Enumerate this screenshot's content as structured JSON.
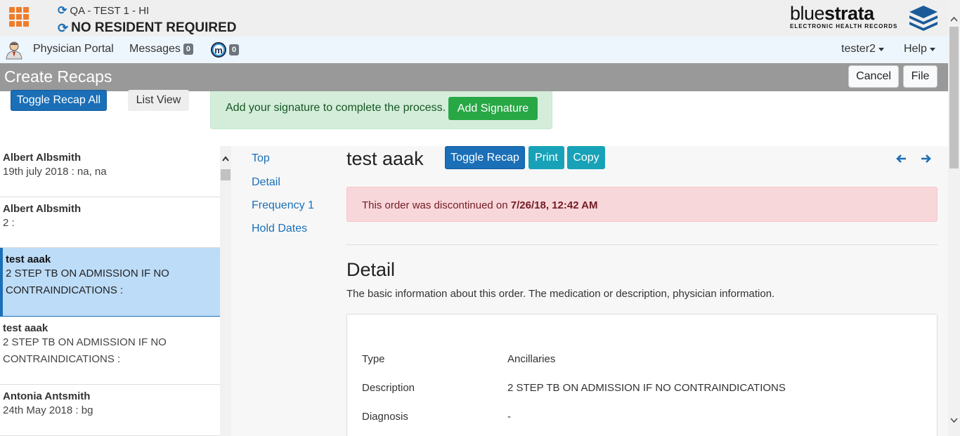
{
  "header": {
    "facility": "QA - TEST 1 - HI",
    "resident": "NO RESIDENT REQUIRED",
    "logo": {
      "name_light": "blue",
      "name_bold": "strata",
      "tagline": "ELECTRONIC HEALTH RECORDS"
    }
  },
  "nav": {
    "physician_portal": "Physician Portal",
    "messages": "Messages",
    "messages_count": "0",
    "m_count": "0",
    "user": "tester2",
    "help": "Help"
  },
  "titlebar": {
    "title": "Create Recaps",
    "cancel": "Cancel",
    "file": "File"
  },
  "controls": {
    "toggle_all": "Toggle Recap All",
    "list_view": "List View",
    "signature_msg": "Add your signature to complete the process.",
    "add_signature": "Add Signature"
  },
  "list": [
    {
      "name": "Albert Albsmith",
      "desc": "19th july 2018 : na, na"
    },
    {
      "name": "Albert Albsmith",
      "desc": "2 :"
    },
    {
      "name": "test aaak",
      "desc": "2 STEP TB ON ADMISSION IF NO CONTRAINDICATIONS :"
    },
    {
      "name": "test aaak",
      "desc": "2 STEP TB ON ADMISSION IF NO CONTRAINDICATIONS :"
    },
    {
      "name": "Antonia Antsmith",
      "desc": "24th May 2018 : bg"
    }
  ],
  "toc": [
    "Top",
    "Detail",
    "Frequency 1",
    "Hold Dates"
  ],
  "order": {
    "title": "test aaak",
    "toggle": "Toggle Recap",
    "print": "Print",
    "copy": "Copy",
    "discontinued_prefix": "This order was discontinued on",
    "discontinued_date": "7/26/18, 12:42 AM",
    "section_title": "Detail",
    "section_desc": "The basic information about this order. The medication or description, physician information.",
    "rows": [
      {
        "label": "Type",
        "value": "Ancillaries"
      },
      {
        "label": "Description",
        "value": "2 STEP TB ON ADMISSION IF NO CONTRAINDICATIONS"
      },
      {
        "label": "Diagnosis",
        "value": "-"
      }
    ]
  },
  "colors": {
    "primary": "#1a6fb7",
    "info": "#17a2b8",
    "success": "#28a745",
    "active_bg": "#bddcf8"
  }
}
